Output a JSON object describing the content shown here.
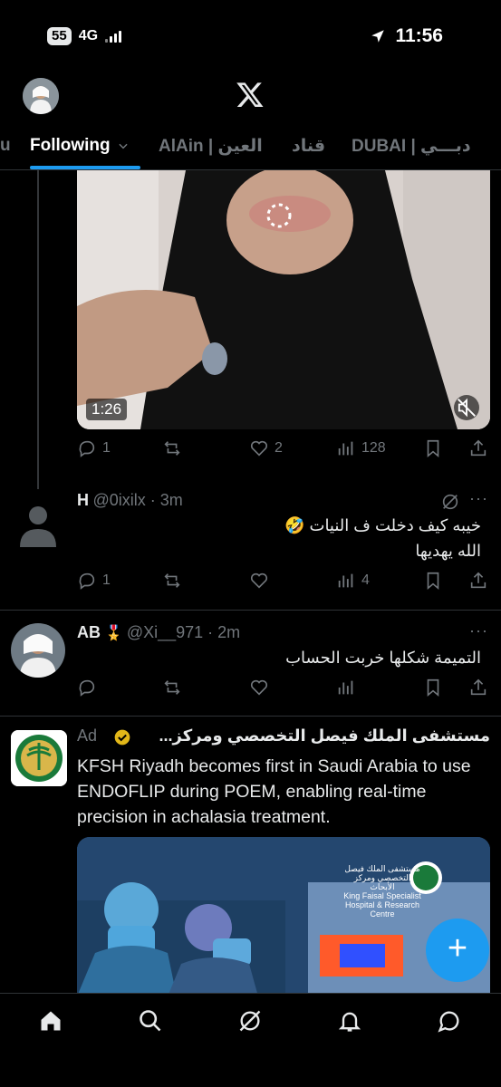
{
  "status_bar": {
    "battery": "55",
    "network": "4G",
    "time": "11:56"
  },
  "tabs": [
    {
      "label": "u"
    },
    {
      "label": "Following"
    },
    {
      "label": "AlAin | العين"
    },
    {
      "label": "قناد"
    },
    {
      "label": "DUBAI | دبـــي"
    }
  ],
  "video_post": {
    "duration": "1:26",
    "replies": "1",
    "reposts": "",
    "likes": "2",
    "views": "128"
  },
  "reply_1": {
    "name": "H",
    "handle": "@0ixilx · 3m",
    "text_line1": "خيبه كيف دخلت ف النيات 🤣",
    "text_line2": "الله يهديها",
    "replies": "1",
    "views": "4"
  },
  "reply_2": {
    "name": "AB",
    "badge": "🎖️",
    "handle": "@Xi__971 · 2m",
    "text": "التميمة شكلها خربت الحساب"
  },
  "ad": {
    "label": "Ad",
    "name": "مستشفى الملك فيصل التخصصي ومركز...",
    "body": "KFSH Riyadh becomes first in Saudi Arabia to use ENDOFLIP during POEM, enabling real-time precision in achalasia treatment.",
    "image_caption_ar": "مستشفى الملك فيصل التخصصي ومركز الأبحاث",
    "image_caption_en": "King Faisal Specialist Hospital & Research Centre"
  },
  "fab": {
    "label": "+"
  },
  "more_label": "···",
  "colors": {
    "accent": "#1d9bf0",
    "background": "#000000",
    "muted": "#71767b"
  },
  "icons": [
    "home-icon",
    "search-icon",
    "grok-icon",
    "notifications-icon",
    "messages-icon"
  ]
}
